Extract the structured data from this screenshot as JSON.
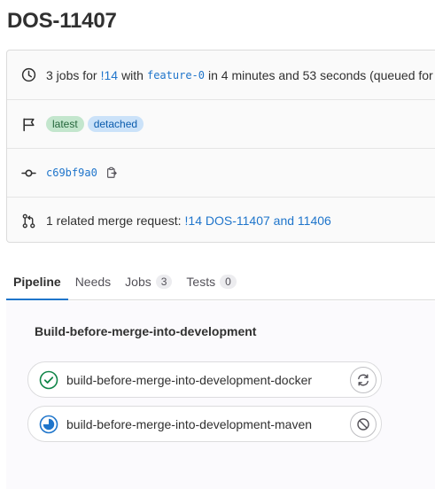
{
  "header": {
    "title": "DOS-11407"
  },
  "info": {
    "summary": {
      "jobs_text": "3 jobs for",
      "mr_link": "!14",
      "with_text": "with",
      "branch": "feature-0",
      "duration_text": "in 4 minutes and 53 seconds (queued for"
    },
    "badges": [
      "latest",
      "detached"
    ],
    "commit": {
      "sha": "c69bf9a0"
    },
    "merge_request": {
      "prefix": "1 related merge request:",
      "link_text": "!14 DOS-11407 and 11406"
    }
  },
  "tabs": [
    {
      "label": "Pipeline",
      "count": null,
      "active": true
    },
    {
      "label": "Needs",
      "count": null,
      "active": false
    },
    {
      "label": "Jobs",
      "count": "3",
      "active": false
    },
    {
      "label": "Tests",
      "count": "0",
      "active": false
    }
  ],
  "pipeline": {
    "stage_name": "Build-before-merge-into-development",
    "jobs": [
      {
        "name": "build-before-merge-into-development-docker",
        "status": "success",
        "action": "retry-icon"
      },
      {
        "name": "build-before-merge-into-development-maven",
        "status": "running",
        "action": "cancel-icon"
      }
    ]
  },
  "colors": {
    "accent": "#1f75cb",
    "success": "#108548",
    "running": "#1f75cb"
  }
}
